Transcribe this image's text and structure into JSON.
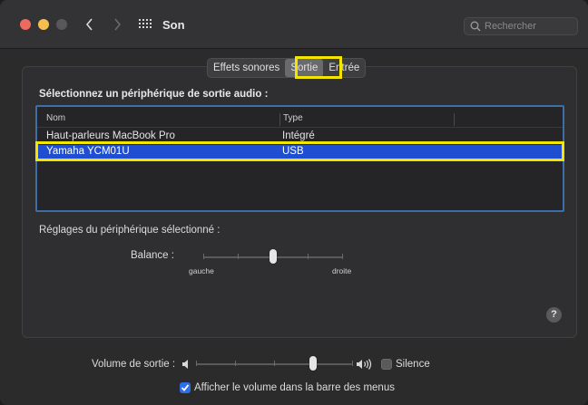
{
  "window": {
    "title": "Son"
  },
  "search": {
    "placeholder": "Rechercher"
  },
  "tabs": [
    "Effets sonores",
    "Sortie",
    "Entrée"
  ],
  "active_tab": "Sortie",
  "output": {
    "heading": "Sélectionnez un périphérique de sortie audio :",
    "columns": [
      "Nom",
      "Type"
    ],
    "rows": [
      {
        "name": "Haut-parleurs MacBook Pro",
        "type": "Intégré"
      },
      {
        "name": "Yamaha YCM01U",
        "type": "USB",
        "selected": true
      }
    ]
  },
  "device_settings": {
    "heading": "Réglages du périphérique sélectionné :",
    "balance_label": "Balance :",
    "left_label": "gauche",
    "right_label": "droite",
    "balance_value": 0.5
  },
  "help_label": "?",
  "volume": {
    "label": "Volume de sortie :",
    "level": 0.75,
    "mute_label": "Silence",
    "mute_checked": false,
    "show_in_menu_bar_label": "Afficher le volume dans la barre des menus",
    "show_in_menu_bar_checked": true
  },
  "colors": {
    "selection": "#1f4fd0",
    "table_border": "#3d6ea8",
    "annotation": "#f3e500",
    "close": "#ed6a5e",
    "minimize": "#f5bf4f"
  }
}
